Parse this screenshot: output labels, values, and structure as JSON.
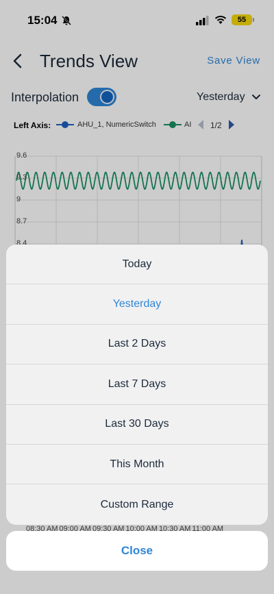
{
  "status": {
    "time": "15:04",
    "battery": "55"
  },
  "header": {
    "title": "Trends View",
    "save_label": "Save View"
  },
  "controls": {
    "interpolation_label": "Interpolation",
    "interpolation_on": true,
    "range_value": "Yesterday"
  },
  "legend": {
    "axis_label": "Left Axis:",
    "series_1": "AHU_1, NumericSwitch",
    "series_2": "AI",
    "page": "1/2"
  },
  "colors": {
    "series_1": "#1f5fbf",
    "series_2": "#1a8f63",
    "accent": "#2f86d6"
  },
  "chart_data": {
    "type": "line",
    "y_ticks": [
      "9.6",
      "9.3",
      "9",
      "8.7",
      "8.4"
    ],
    "x_ticks": [
      "08:30 AM",
      "09:00 AM",
      "09:30 AM",
      "10:00 AM",
      "10:30 AM",
      "11:00 AM"
    ],
    "ylim": [
      8.4,
      9.6
    ],
    "series": [
      {
        "name": "AI",
        "oscillation_min": 9.15,
        "oscillation_max": 9.38,
        "cycles": 28
      }
    ]
  },
  "sheet": {
    "options": [
      "Today",
      "Yesterday",
      "Last 2 Days",
      "Last 7 Days",
      "Last 30 Days",
      "This Month",
      "Custom Range"
    ],
    "selected": "Yesterday",
    "close_label": "Close"
  }
}
